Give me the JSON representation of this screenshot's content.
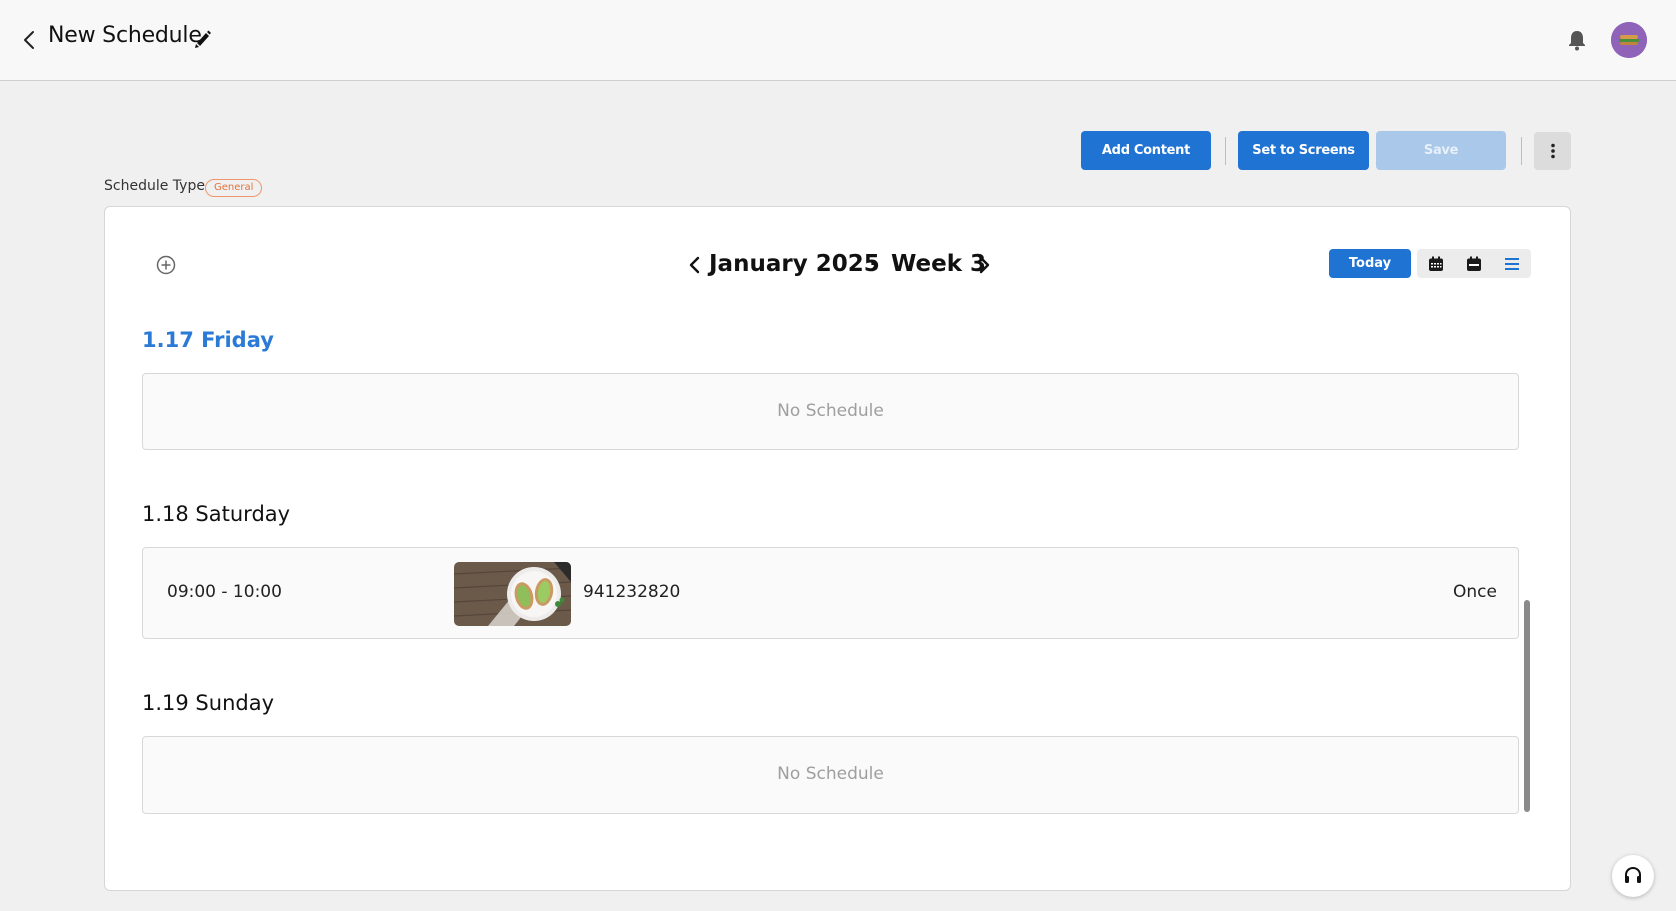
{
  "header": {
    "title": "New Schedule",
    "back_icon": "chevron-left-icon",
    "edit_icon": "pencil-icon",
    "notification_icon": "bell-icon",
    "avatar_icon": "avatar"
  },
  "toolbar": {
    "add_content_label": "Add Content",
    "set_to_screens_label": "Set to Screens",
    "save_label": "Save",
    "save_enabled": false,
    "more_icon": "vertical-dots-icon"
  },
  "schedule_type": {
    "label": "Schedule Type",
    "badge": "General"
  },
  "calendar": {
    "month": "January 2025",
    "separator": "·",
    "week": "Week 3",
    "today_label": "Today",
    "views": [
      "month-view-icon",
      "week-view-icon",
      "list-view-icon"
    ],
    "active_view": "list-view-icon",
    "days": [
      {
        "heading": "1.17 Friday",
        "is_today": true,
        "empty_text": "No Schedule",
        "events": []
      },
      {
        "heading": "1.18 Saturday",
        "is_today": false,
        "events": [
          {
            "time": "09:00 - 10:00",
            "name": "941232820",
            "repeat": "Once"
          }
        ]
      },
      {
        "heading": "1.19 Sunday",
        "is_today": false,
        "empty_text": "No Schedule",
        "events": []
      }
    ]
  },
  "colors": {
    "primary": "#1f73d3",
    "primary_disabled": "#a9c8ea",
    "today_heading": "#2a7ad6",
    "badge": "#e2733e"
  },
  "support_icon": "headset-icon"
}
